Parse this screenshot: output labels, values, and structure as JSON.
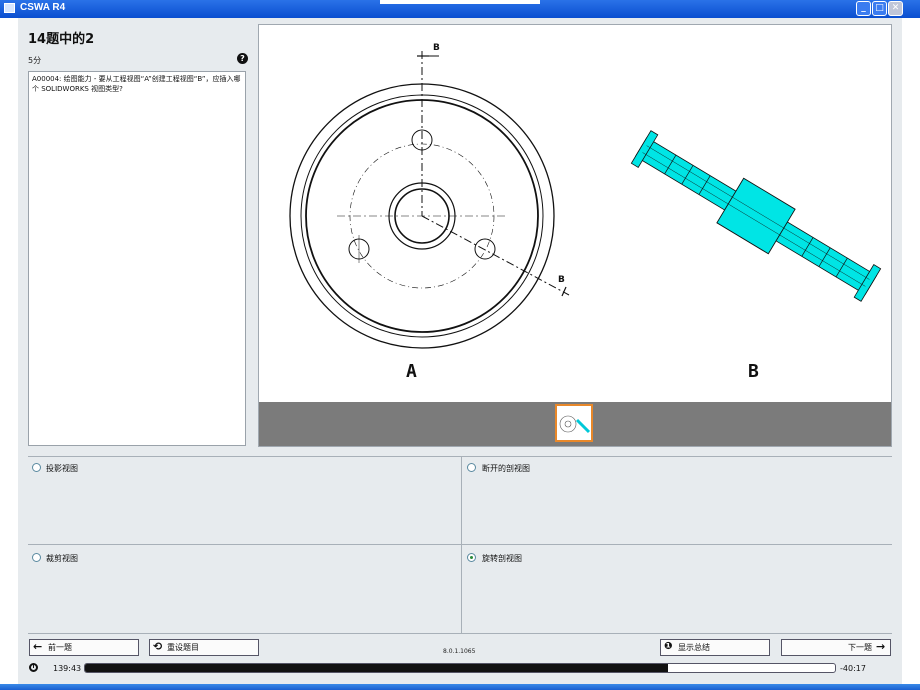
{
  "window": {
    "title": "CSWA R4"
  },
  "question": {
    "header": "14题中的2",
    "points": "5分",
    "text": "A00004: 绘图能力 - 要从工程视图“A”创建工程视图“B”，应插入哪个 SOLIDWORKS 视图类型?"
  },
  "figure": {
    "label_a": "A",
    "label_b": "B",
    "section_label": "B"
  },
  "answers": [
    {
      "label": "投影视图",
      "selected": false
    },
    {
      "label": "断开的剖视图",
      "selected": false
    },
    {
      "label": "裁剪视图",
      "selected": false
    },
    {
      "label": "旋转剖视图",
      "selected": true
    }
  ],
  "footer": {
    "prev_label": "前一题",
    "reset_label": "重设题目",
    "version": "8.0.1.1065",
    "summary_label": "显示总结",
    "next_label": "下一题",
    "elapsed": "139:43",
    "remaining": "-40:17",
    "progress": 0.777
  },
  "colors": {
    "accent": "#00e0e0",
    "thumb_border": "#e8882a"
  }
}
